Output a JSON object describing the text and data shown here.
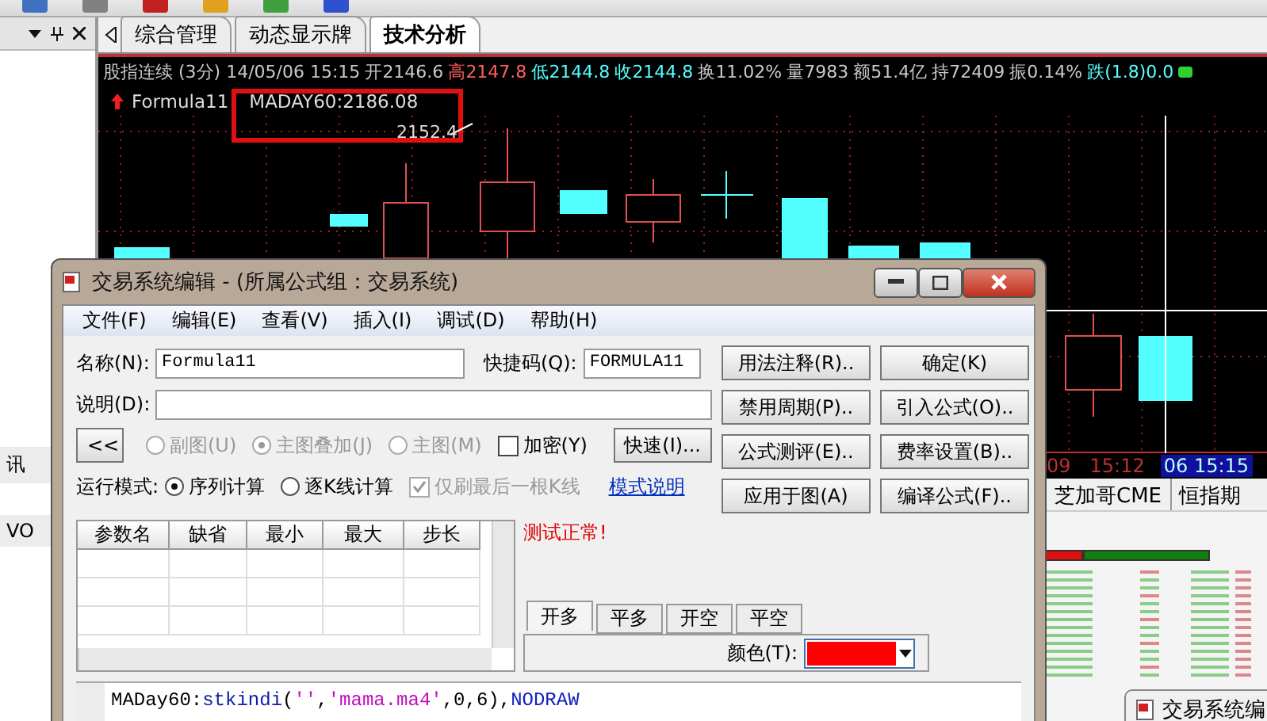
{
  "left_panel": {
    "items": [
      {
        "label": "讯"
      },
      {
        "label": "VO"
      }
    ]
  },
  "tabs": [
    {
      "label": "综合管理",
      "selected": false
    },
    {
      "label": "动态显示牌",
      "selected": false
    },
    {
      "label": "技术分析",
      "selected": true
    }
  ],
  "chart": {
    "title": "股指连续 (3分) 14/05/06 15:15",
    "quotes": [
      {
        "label": "开2146.6",
        "color": "#c8c8c8"
      },
      {
        "label": "高2147.8",
        "color": "#ff6060"
      },
      {
        "label": "低2144.8",
        "color": "#54ffff"
      },
      {
        "label": "收2144.8",
        "color": "#54ffff"
      },
      {
        "label": "换11.02%",
        "color": "#c8c8c8"
      },
      {
        "label": "量7983",
        "color": "#c8c8c8"
      },
      {
        "label": "额51.4亿",
        "color": "#c8c8c8"
      },
      {
        "label": "持72409",
        "color": "#c8c8c8"
      },
      {
        "label": "振0.14%",
        "color": "#c8c8c8"
      },
      {
        "label": "跌(1.8)0.0",
        "color": "#54ffff"
      }
    ],
    "formula": "Formula11",
    "indicator": "MADAY60:2186.08",
    "price_label": "2152.4",
    "time_axis": [
      {
        "label": "09",
        "selected": false
      },
      {
        "label": "15:12",
        "selected": false
      },
      {
        "label": "06 15:15",
        "selected": true
      }
    ]
  },
  "bottom_panel": {
    "tabs": [
      {
        "label": "芝加哥CME"
      },
      {
        "label": "恒指期"
      }
    ],
    "window_title": "交易系统编"
  },
  "dialog": {
    "title": "交易系统编辑 - (所属公式组：交易系统)",
    "menu": [
      "文件(F)",
      "编辑(E)",
      "查看(V)",
      "插入(I)",
      "调试(D)",
      "帮助(H)"
    ],
    "name": {
      "label": "名称(N):",
      "value": "Formula11"
    },
    "shortcut": {
      "label": "快捷码(Q):",
      "value": "FORMULA11"
    },
    "description": {
      "label": "说明(D):"
    },
    "collapse_button": "<<",
    "chart_types": [
      {
        "label": "副图(U)",
        "selected": false,
        "disabled": true
      },
      {
        "label": "主图叠加(J)",
        "selected": true,
        "disabled": true
      },
      {
        "label": "主图(M)",
        "selected": false,
        "disabled": true
      }
    ],
    "encrypt": {
      "label": "加密(Y)",
      "checked": false,
      "disabled": false
    },
    "quick_button": "快速(I)...",
    "run_mode": {
      "label": "运行模式:",
      "options": [
        {
          "label": "序列计算",
          "selected": true
        },
        {
          "label": "逐K线计算",
          "selected": false
        }
      ]
    },
    "refresh_last": {
      "label": "仅刷最后一根K线",
      "checked": true,
      "disabled": true
    },
    "mode_link": "模式说明",
    "buttons": [
      "用法注释(R)..",
      "确定(K)",
      "禁用周期(P)..",
      "引入公式(O)..",
      "公式测评(E)..",
      "费率设置(B)..",
      "应用于图(A)",
      "编译公式(F).."
    ],
    "params_table": {
      "columns": [
        "参数名",
        "缺省",
        "最小",
        "最大",
        "步长"
      ]
    },
    "status": "测试正常!",
    "signal_tabs": [
      {
        "label": "开多",
        "selected": true
      },
      {
        "label": "平多",
        "selected": false
      },
      {
        "label": "开空",
        "selected": false
      },
      {
        "label": "平空",
        "selected": false
      }
    ],
    "color_picker": {
      "label": "颜色(T):",
      "color": "#ff0000"
    },
    "code": [
      {
        "kind": "plain",
        "text": "MADay60:"
      },
      {
        "kind": "function",
        "text": "stkindi"
      },
      {
        "kind": "plain",
        "text": "("
      },
      {
        "kind": "string",
        "text": "''"
      },
      {
        "kind": "plain",
        "text": ","
      },
      {
        "kind": "string",
        "text": "'mama.ma4'"
      },
      {
        "kind": "plain",
        "text": ",0,6),"
      },
      {
        "kind": "keyword",
        "text": "NODRAW"
      }
    ]
  }
}
